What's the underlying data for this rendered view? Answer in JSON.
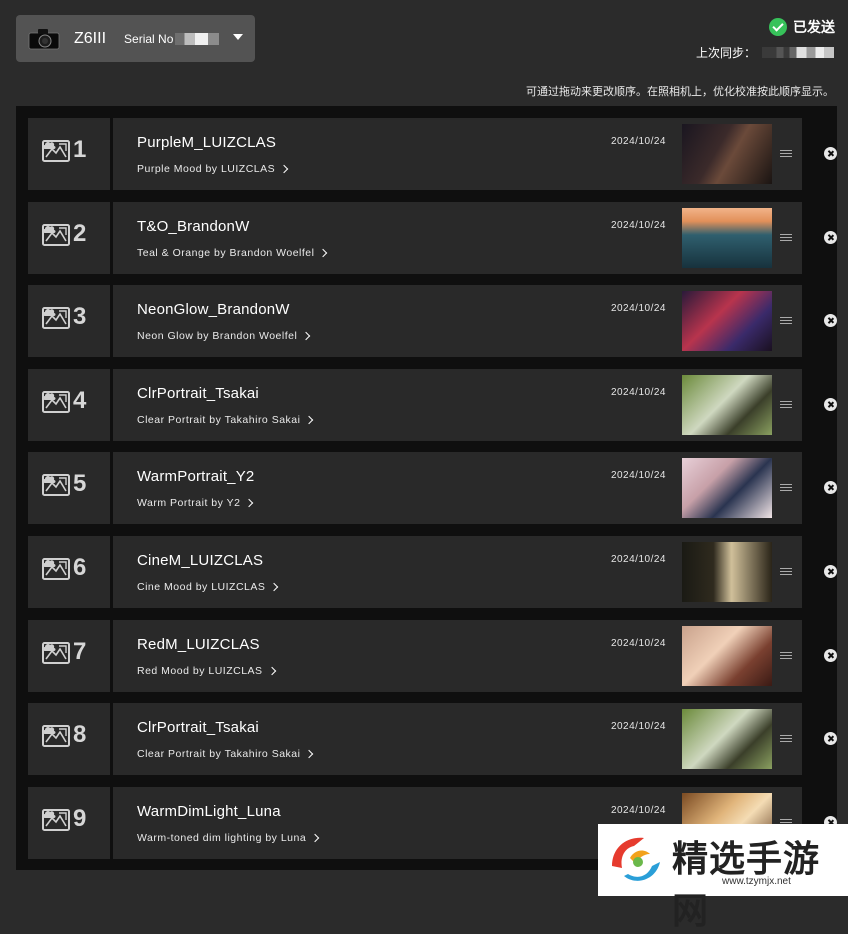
{
  "header": {
    "camera_model": "Z6III",
    "serial_label": "Serial No",
    "status_text": "已发送",
    "last_sync_label": "上次同步：",
    "hint_text": "可通过拖动来更改顺序。在照相机上，优化校准按此顺序显示。"
  },
  "presets": [
    {
      "slot": "1",
      "name": "PurpleM_LUIZCLAS",
      "desc": "Purple Mood by LUIZCLAS",
      "date": "2024/10/24"
    },
    {
      "slot": "2",
      "name": "T&O_BrandonW",
      "desc": "Teal & Orange by Brandon Woelfel",
      "date": "2024/10/24"
    },
    {
      "slot": "3",
      "name": "NeonGlow_BrandonW",
      "desc": "Neon Glow by Brandon Woelfel",
      "date": "2024/10/24"
    },
    {
      "slot": "4",
      "name": "ClrPortrait_Tsakai",
      "desc": "Clear Portrait by Takahiro Sakai",
      "date": "2024/10/24"
    },
    {
      "slot": "5",
      "name": "WarmPortrait_Y2",
      "desc": "Warm Portrait by Y2",
      "date": "2024/10/24"
    },
    {
      "slot": "6",
      "name": "CineM_LUIZCLAS",
      "desc": "Cine Mood by LUIZCLAS",
      "date": "2024/10/24"
    },
    {
      "slot": "7",
      "name": "RedM_LUIZCLAS",
      "desc": "Red Mood by LUIZCLAS",
      "date": "2024/10/24"
    },
    {
      "slot": "8",
      "name": "ClrPortrait_Tsakai",
      "desc": "Clear Portrait by Takahiro Sakai",
      "date": "2024/10/24"
    },
    {
      "slot": "9",
      "name": "WarmDimLight_Luna",
      "desc": "Warm-toned dim lighting by Luna",
      "date": "2024/10/24"
    }
  ],
  "icons": {
    "camera": "camera-icon",
    "dropdown": "chevron-down-icon",
    "status": "check-circle-icon",
    "slot": "picture-control-icon",
    "cloud": "cloud-icon",
    "drag": "drag-handle-icon",
    "remove": "close-circle-icon"
  },
  "colors": {
    "background": "#2b2b2b",
    "panel": "#0f0f0f",
    "row": "#292929",
    "success": "#37c25a"
  },
  "watermark": {
    "title": "精选手游网",
    "url": "www.tzymjx.net"
  }
}
